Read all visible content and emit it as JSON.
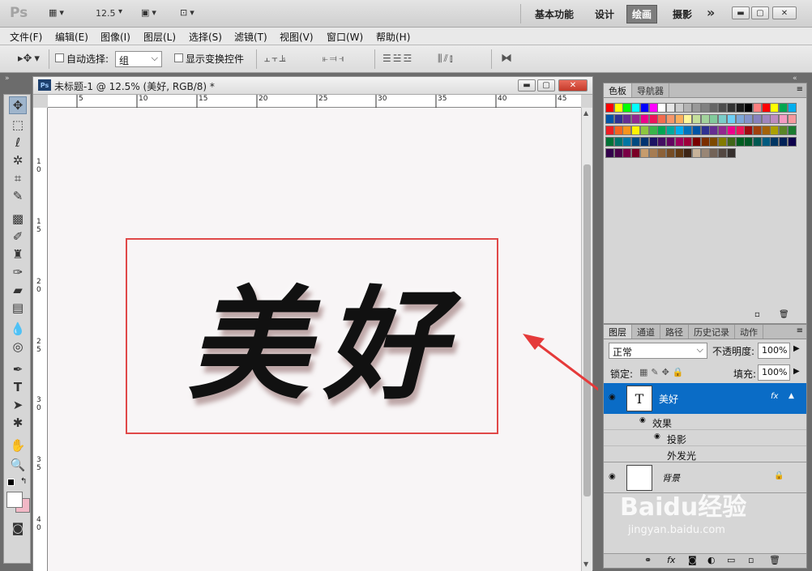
{
  "app": {
    "logo": "Ps",
    "zoom": "12.5"
  },
  "workspaces": {
    "items": [
      "基本功能",
      "设计",
      "绘画",
      "摄影"
    ],
    "active": "绘画",
    "more": "»"
  },
  "menu": [
    "文件(F)",
    "编辑(E)",
    "图像(I)",
    "图层(L)",
    "选择(S)",
    "滤镜(T)",
    "视图(V)",
    "窗口(W)",
    "帮助(H)"
  ],
  "options": {
    "auto_select_label": "自动选择:",
    "auto_select_value": "组",
    "show_transform_label": "显示变换控件"
  },
  "document": {
    "title": "未标题-1 @ 12.5% (美好, RGB/8) *",
    "canvas_text": "美好",
    "ruler_h": [
      "5",
      "10",
      "15",
      "20",
      "25",
      "30",
      "35",
      "40",
      "45"
    ],
    "ruler_v": [
      "1",
      "0",
      "1",
      "5",
      "2",
      "0",
      "2",
      "5",
      "3",
      "0",
      "3",
      "5",
      "4",
      "0"
    ]
  },
  "swatch_panel": {
    "tabs": [
      "色板",
      "导航器"
    ]
  },
  "layers_panel": {
    "tabs": [
      "图层",
      "通道",
      "路径",
      "历史记录",
      "动作"
    ],
    "blend_mode": "正常",
    "opacity_label": "不透明度:",
    "opacity_value": "100%",
    "lock_label": "锁定:",
    "fill_label": "填充:",
    "fill_value": "100%",
    "layers": [
      {
        "name": "美好",
        "type": "T",
        "fx": "fx"
      },
      {
        "name": "背景"
      }
    ],
    "effects_label": "效果",
    "effects": [
      "投影",
      "外发光"
    ]
  },
  "watermark": {
    "text": "Baidu经验",
    "url": "jingyan.baidu.com"
  },
  "colors": {
    "accent": "#0a6cc6",
    "annotation": "#e53a3a"
  }
}
